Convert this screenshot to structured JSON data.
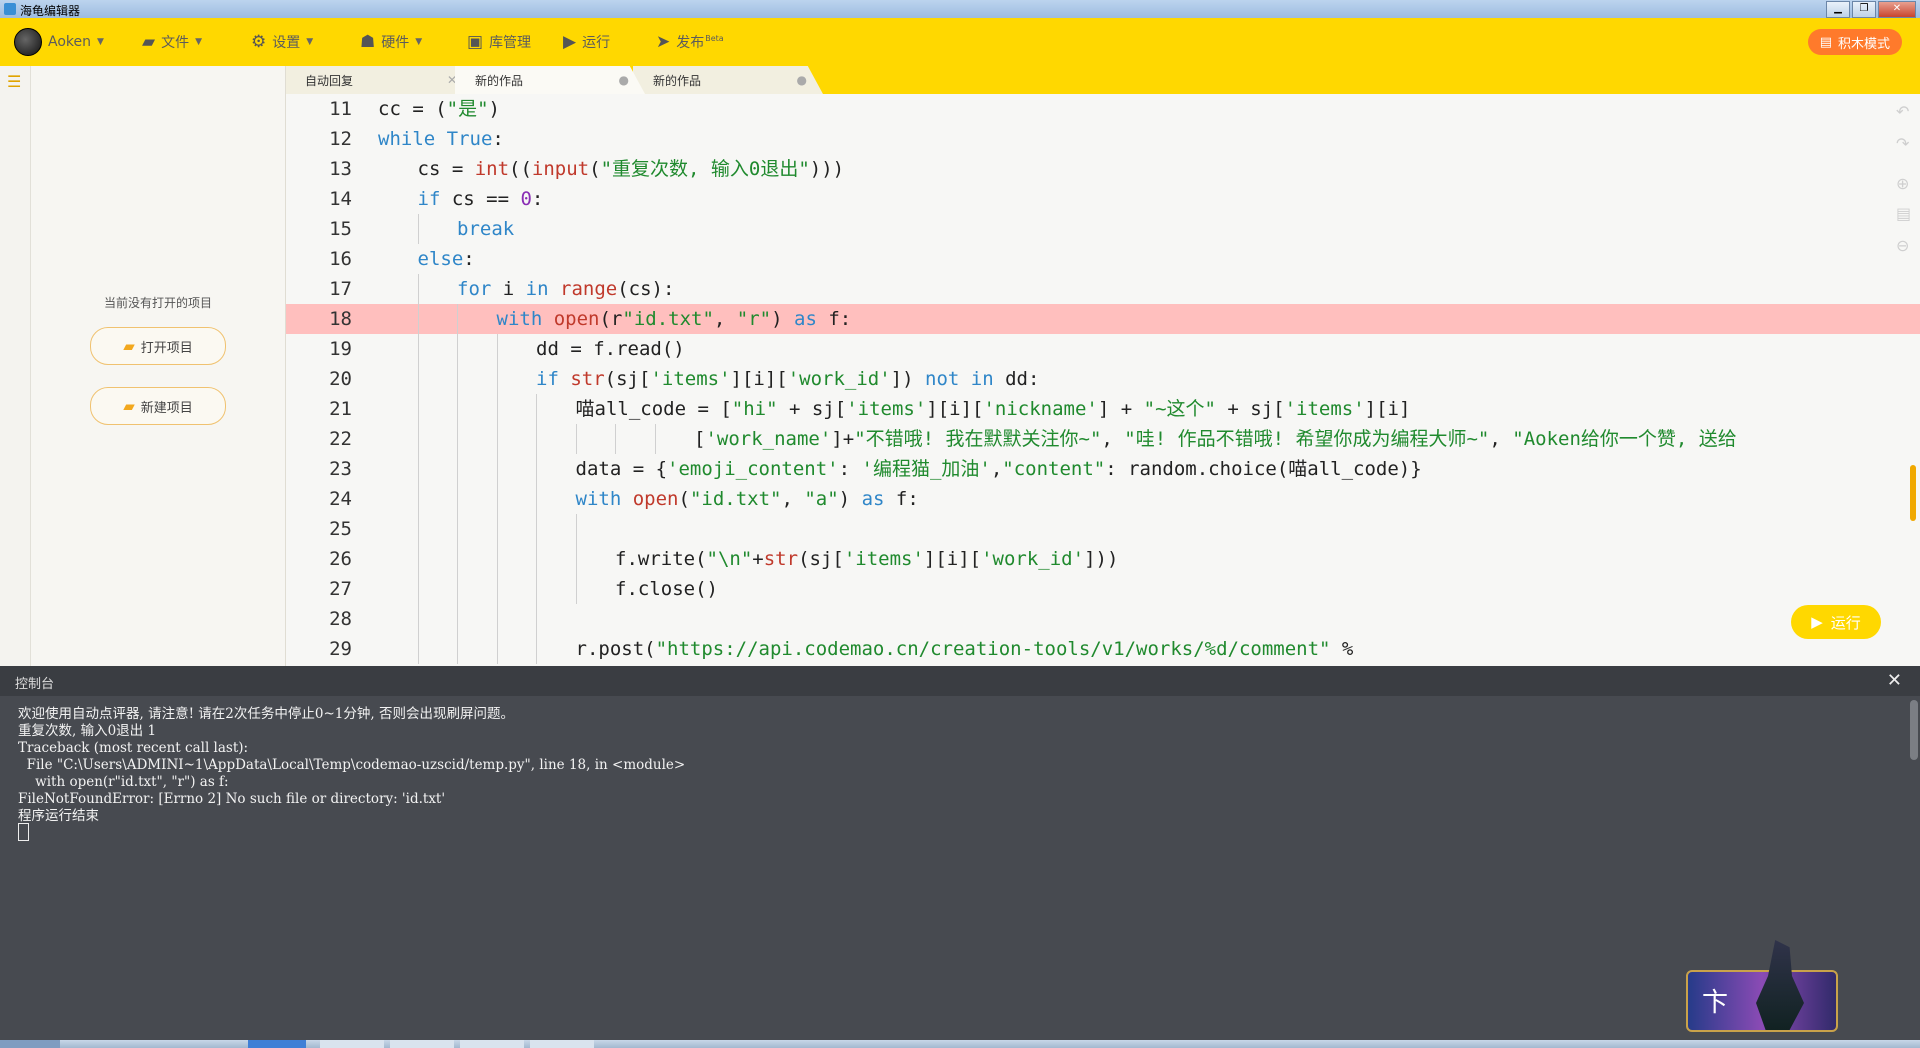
{
  "window": {
    "title": "海龟编辑器"
  },
  "menubar": {
    "user": "Aoken",
    "file": "文件",
    "settings": "设置",
    "hardware": "硬件",
    "library": "库管理",
    "run": "运行",
    "publish": "发布",
    "publish_badge": "Beta",
    "block_mode": "积木模式"
  },
  "tabs": [
    {
      "label": "自动回复",
      "close": "✕"
    },
    {
      "label": "新的作品",
      "close": "●"
    },
    {
      "label": "新的作品",
      "close": "●"
    }
  ],
  "project_panel": {
    "empty_text": "当前没有打开的项目",
    "open_button": "打开项目",
    "new_button": "新建项目"
  },
  "editor": {
    "highlight_line": 18,
    "lines": [
      {
        "n": "11",
        "indent": 0,
        "tokens": [
          [
            "pl",
            "cc = ("
          ],
          [
            "st",
            "\"是\""
          ],
          [
            "pl",
            ")"
          ]
        ]
      },
      {
        "n": "12",
        "indent": 0,
        "tokens": [
          [
            "kw",
            "while"
          ],
          [
            "pl",
            " "
          ],
          [
            "kw",
            "True"
          ],
          [
            "pl",
            ":"
          ]
        ]
      },
      {
        "n": "13",
        "indent": 1,
        "tokens": [
          [
            "pl",
            "cs = "
          ],
          [
            "bi",
            "int"
          ],
          [
            "pl",
            "(("
          ],
          [
            "bi",
            "input"
          ],
          [
            "pl",
            "("
          ],
          [
            "st",
            "\"重复次数, 输入0退出\""
          ],
          [
            "pl",
            ")))"
          ]
        ]
      },
      {
        "n": "14",
        "indent": 1,
        "tokens": [
          [
            "kw",
            "if"
          ],
          [
            "pl",
            " cs == "
          ],
          [
            "nm",
            "0"
          ],
          [
            "pl",
            ":"
          ]
        ]
      },
      {
        "n": "15",
        "indent": 2,
        "tokens": [
          [
            "kw",
            "break"
          ]
        ]
      },
      {
        "n": "16",
        "indent": 1,
        "tokens": [
          [
            "kw",
            "else"
          ],
          [
            "pl",
            ":"
          ]
        ]
      },
      {
        "n": "17",
        "indent": 2,
        "tokens": [
          [
            "kw",
            "for"
          ],
          [
            "pl",
            " i "
          ],
          [
            "kw",
            "in"
          ],
          [
            "pl",
            " "
          ],
          [
            "bi",
            "range"
          ],
          [
            "pl",
            "(cs):"
          ]
        ]
      },
      {
        "n": "18",
        "indent": 3,
        "tokens": [
          [
            "kw",
            "with"
          ],
          [
            "pl",
            " "
          ],
          [
            "bi",
            "open"
          ],
          [
            "pl",
            "(r"
          ],
          [
            "st",
            "\"id.txt\""
          ],
          [
            "pl",
            ", "
          ],
          [
            "st",
            "\"r\""
          ],
          [
            "pl",
            ") "
          ],
          [
            "kw",
            "as"
          ],
          [
            "pl",
            " f:"
          ]
        ]
      },
      {
        "n": "19",
        "indent": 4,
        "tokens": [
          [
            "pl",
            "dd = f.read()"
          ]
        ]
      },
      {
        "n": "20",
        "indent": 4,
        "tokens": [
          [
            "kw",
            "if"
          ],
          [
            "pl",
            " "
          ],
          [
            "bi",
            "str"
          ],
          [
            "pl",
            "(sj["
          ],
          [
            "st",
            "'items'"
          ],
          [
            "pl",
            "][i]["
          ],
          [
            "st",
            "'work_id'"
          ],
          [
            "pl",
            "]) "
          ],
          [
            "kw",
            "not in"
          ],
          [
            "pl",
            " dd:"
          ]
        ]
      },
      {
        "n": "21",
        "indent": 5,
        "tokens": [
          [
            "pl",
            "喵all_code = ["
          ],
          [
            "st",
            "\"hi\""
          ],
          [
            "pl",
            " + sj["
          ],
          [
            "st",
            "'items'"
          ],
          [
            "pl",
            "][i]["
          ],
          [
            "st",
            "'nickname'"
          ],
          [
            "pl",
            "] + "
          ],
          [
            "st",
            "\"~这个\""
          ],
          [
            "pl",
            " + sj["
          ],
          [
            "st",
            "'items'"
          ],
          [
            "pl",
            "][i]"
          ]
        ]
      },
      {
        "n": "22",
        "indent": 8,
        "tokens": [
          [
            "pl",
            "["
          ],
          [
            "st",
            "'work_name'"
          ],
          [
            "pl",
            "]+"
          ],
          [
            "st",
            "\"不错哦! 我在默默关注你~\""
          ],
          [
            "pl",
            ", "
          ],
          [
            "st",
            "\"哇! 作品不错哦! 希望你成为编程大师~\""
          ],
          [
            "pl",
            ", "
          ],
          [
            "st",
            "\"Aoken给你一个赞, 送给"
          ]
        ]
      },
      {
        "n": "23",
        "indent": 5,
        "tokens": [
          [
            "pl",
            "data = {"
          ],
          [
            "st",
            "'emoji_content'"
          ],
          [
            "pl",
            ": "
          ],
          [
            "st",
            "'编程猫_加油'"
          ],
          [
            "pl",
            ","
          ],
          [
            "st",
            "\"content\""
          ],
          [
            "pl",
            ": random.choice(喵all_code)}"
          ]
        ]
      },
      {
        "n": "24",
        "indent": 5,
        "tokens": [
          [
            "kw",
            "with"
          ],
          [
            "pl",
            " "
          ],
          [
            "bi",
            "open"
          ],
          [
            "pl",
            "("
          ],
          [
            "st",
            "\"id.txt\""
          ],
          [
            "pl",
            ", "
          ],
          [
            "st",
            "\"a\""
          ],
          [
            "pl",
            ") "
          ],
          [
            "kw",
            "as"
          ],
          [
            "pl",
            " f:"
          ]
        ]
      },
      {
        "n": "25",
        "indent": 6,
        "tokens": []
      },
      {
        "n": "26",
        "indent": 6,
        "tokens": [
          [
            "pl",
            "f.write("
          ],
          [
            "st",
            "\"\\n\""
          ],
          [
            "pl",
            "+"
          ],
          [
            "bi",
            "str"
          ],
          [
            "pl",
            "(sj["
          ],
          [
            "st",
            "'items'"
          ],
          [
            "pl",
            "][i]["
          ],
          [
            "st",
            "'work_id'"
          ],
          [
            "pl",
            "]))"
          ]
        ]
      },
      {
        "n": "27",
        "indent": 6,
        "tokens": [
          [
            "pl",
            "f.close()"
          ]
        ]
      },
      {
        "n": "28",
        "indent": 5,
        "tokens": []
      },
      {
        "n": "29",
        "indent": 5,
        "tokens": [
          [
            "pl",
            "r.post("
          ],
          [
            "st",
            "\"https://api.codemao.cn/creation-tools/v1/works/%d/comment\""
          ],
          [
            "pl",
            " %"
          ]
        ]
      }
    ],
    "run_button": "运行"
  },
  "console": {
    "title": "控制台",
    "close": "✕",
    "lines": [
      "欢迎使用自动点评器, 请注意! 请在2次任务中停止0~1分钟, 否则会出现刷屏问题。",
      "重复次数, 输入0退出 1",
      "Traceback (most recent call last):",
      "  File \"C:\\Users\\ADMINI~1\\AppData\\Local\\Temp\\codemao-uzscid/temp.py\", line 18, in <module>",
      "    with open(r\"id.txt\", \"r\") as f:",
      "FileNotFoundError: [Errno 2] No such file or directory: 'id.txt'",
      "程序运行结束"
    ]
  },
  "colors": {
    "accent": "#ffd800",
    "keyword": "#2f86c8",
    "builtin": "#c0392b",
    "string": "#208a2e",
    "error_highlight": "#ffbfbe",
    "console_bg": "#474a50"
  }
}
